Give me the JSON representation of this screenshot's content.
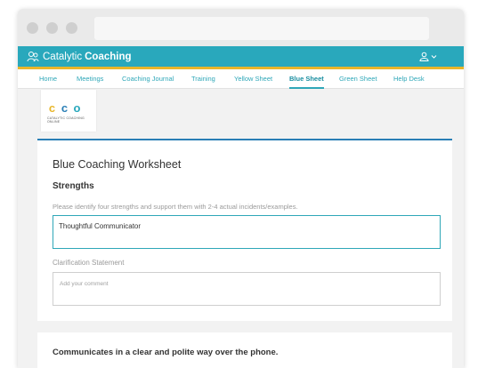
{
  "colors": {
    "header_bg": "#29a8bc",
    "header_accent": "#e8b62a",
    "nav_link": "#2fa7b8",
    "card_border": "#2a7fb6"
  },
  "header": {
    "brand_light": "Catalytic",
    "brand_strong": "Coaching",
    "brand_icon": "people-icon",
    "user_icon": "user-icon",
    "chevron_icon": "chevron-down-icon"
  },
  "nav": {
    "items": [
      {
        "label": "Home"
      },
      {
        "label": "Meetings"
      },
      {
        "label": "Coaching Journal"
      },
      {
        "label": "Training"
      },
      {
        "label": "Yellow Sheet"
      },
      {
        "label": "Blue Sheet",
        "active": true
      },
      {
        "label": "Green Sheet"
      },
      {
        "label": "Help Desk"
      }
    ]
  },
  "logo": {
    "letters": [
      "c",
      "c",
      "o"
    ],
    "letter_colors": [
      "#e8b62a",
      "#2a7fb6",
      "#29a8bc"
    ],
    "tagline": "CATALYTIC COACHING ONLINE"
  },
  "worksheet": {
    "title": "Blue Coaching Worksheet",
    "section_heading": "Strengths",
    "instructions": "Please identify four strengths and support them with 2-4 actual incidents/examples.",
    "strength_value": "Thoughtful Communicator",
    "clarification_label": "Clarification Statement",
    "comment_placeholder": "Add your comment"
  },
  "second_card": {
    "title": "Communicates in a clear and polite way over the phone."
  }
}
